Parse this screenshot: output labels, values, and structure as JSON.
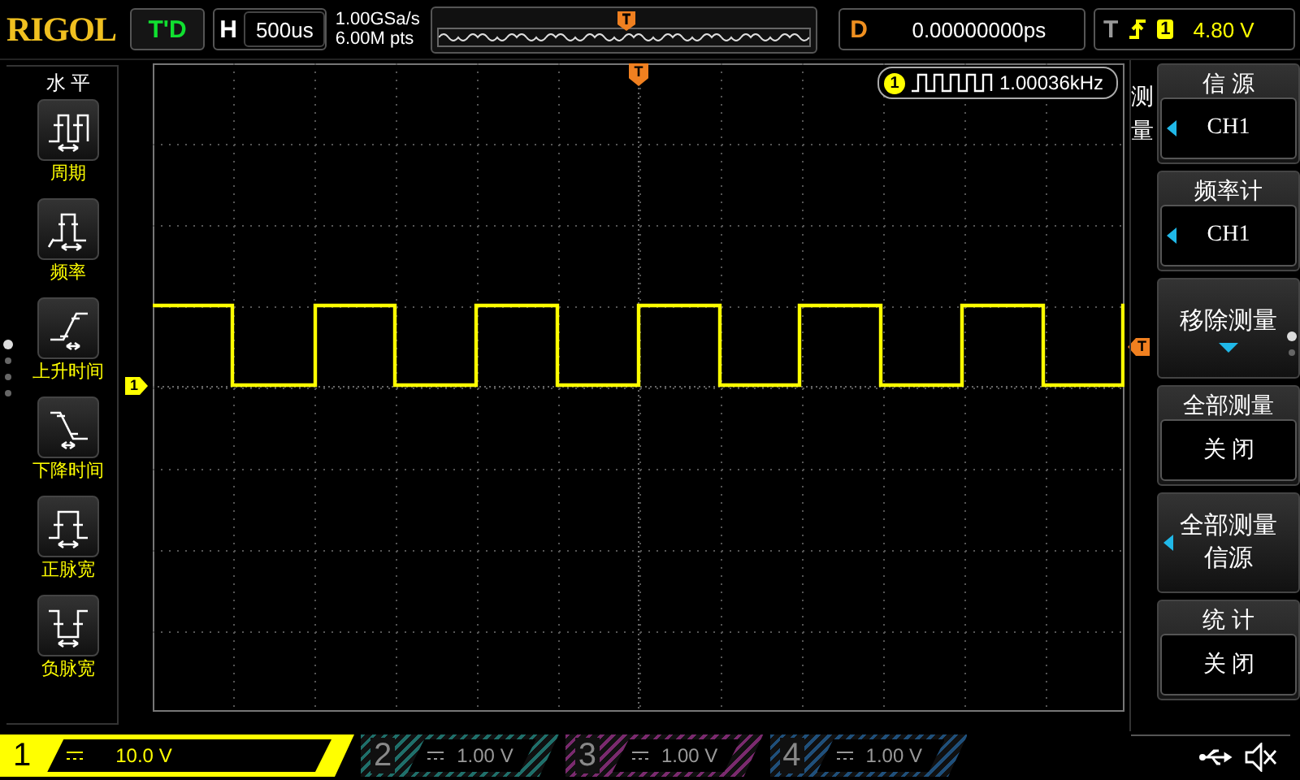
{
  "top_bar": {
    "logo": "RIGOL",
    "run_status": "T'D",
    "horizontal": {
      "label": "H",
      "value": "500us"
    },
    "sample_rate": "1.00GSa/s",
    "memory_depth": "6.00M pts",
    "delay": {
      "label": "D",
      "value": "0.00000000ps"
    },
    "trigger": {
      "label": "T",
      "source": "1",
      "level": "4.80 V"
    }
  },
  "left_menu": {
    "title": "水 平",
    "items": [
      {
        "kind": "period",
        "label": "周期"
      },
      {
        "kind": "frequency",
        "label": "频率"
      },
      {
        "kind": "rise_time",
        "label": "上升时间"
      },
      {
        "kind": "fall_time",
        "label": "下降时间"
      },
      {
        "kind": "positive_width",
        "label": "正脉宽"
      },
      {
        "kind": "negative_width",
        "label": "负脉宽"
      }
    ]
  },
  "display": {
    "trigger_position_marker": "T",
    "trigger_level_marker": "T",
    "channel_marker": "1",
    "frequency_counter": {
      "channel": "1",
      "value": "1.00036kHz"
    }
  },
  "right_menu": {
    "title": "测量",
    "items": [
      {
        "kind": "option",
        "title": "信 源",
        "value": "CH1",
        "arrow": true
      },
      {
        "kind": "option",
        "title": "频率计",
        "value": "CH1",
        "arrow": true
      },
      {
        "kind": "submenu",
        "lines": [
          "移除测量"
        ],
        "arrow": false
      },
      {
        "kind": "option",
        "title": "全部测量",
        "value": "关 闭",
        "arrow": false
      },
      {
        "kind": "button",
        "lines": [
          "全部测量",
          "信源"
        ],
        "arrow": true
      },
      {
        "kind": "option",
        "title": "统 计",
        "value": "关 闭",
        "arrow": false
      }
    ]
  },
  "channels": [
    {
      "number": "1",
      "scale": "10.0 V",
      "color": "#ffff00",
      "on": true
    },
    {
      "number": "2",
      "scale": "1.00 V",
      "color": "#1f6f6a",
      "on": false
    },
    {
      "number": "3",
      "scale": "1.00 V",
      "color": "#7a2a6e",
      "on": false
    },
    {
      "number": "4",
      "scale": "1.00 V",
      "color": "#1f4f7a",
      "on": false
    }
  ]
}
